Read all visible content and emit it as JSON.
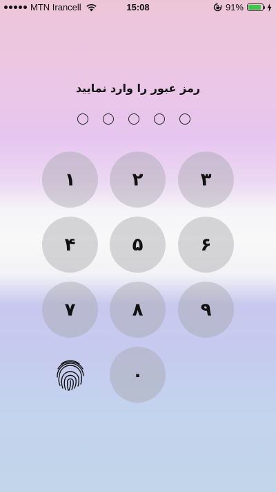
{
  "status_bar": {
    "carrier": "MTN Irancell",
    "time": "15:08",
    "battery_text": "91%",
    "battery_level": 0.91,
    "battery_color": "#3ec74a",
    "icons": [
      "signal-icon",
      "wifi-icon",
      "orientation-lock-icon",
      "battery-icon",
      "charging-bolt-icon"
    ]
  },
  "passcode": {
    "title": "رمز عبور را وارد نمایید",
    "digits_total": 5,
    "digits_entered": 0
  },
  "keypad": {
    "keys": [
      {
        "label": "۱",
        "name": "key-1"
      },
      {
        "label": "۲",
        "name": "key-2"
      },
      {
        "label": "۳",
        "name": "key-3"
      },
      {
        "label": "۴",
        "name": "key-4"
      },
      {
        "label": "۵",
        "name": "key-5"
      },
      {
        "label": "۶",
        "name": "key-6"
      },
      {
        "label": "۷",
        "name": "key-7"
      },
      {
        "label": "۸",
        "name": "key-8"
      },
      {
        "label": "۹",
        "name": "key-9"
      },
      {
        "label": "۰",
        "name": "key-0"
      }
    ],
    "touch_id_icon": "fingerprint-icon"
  }
}
